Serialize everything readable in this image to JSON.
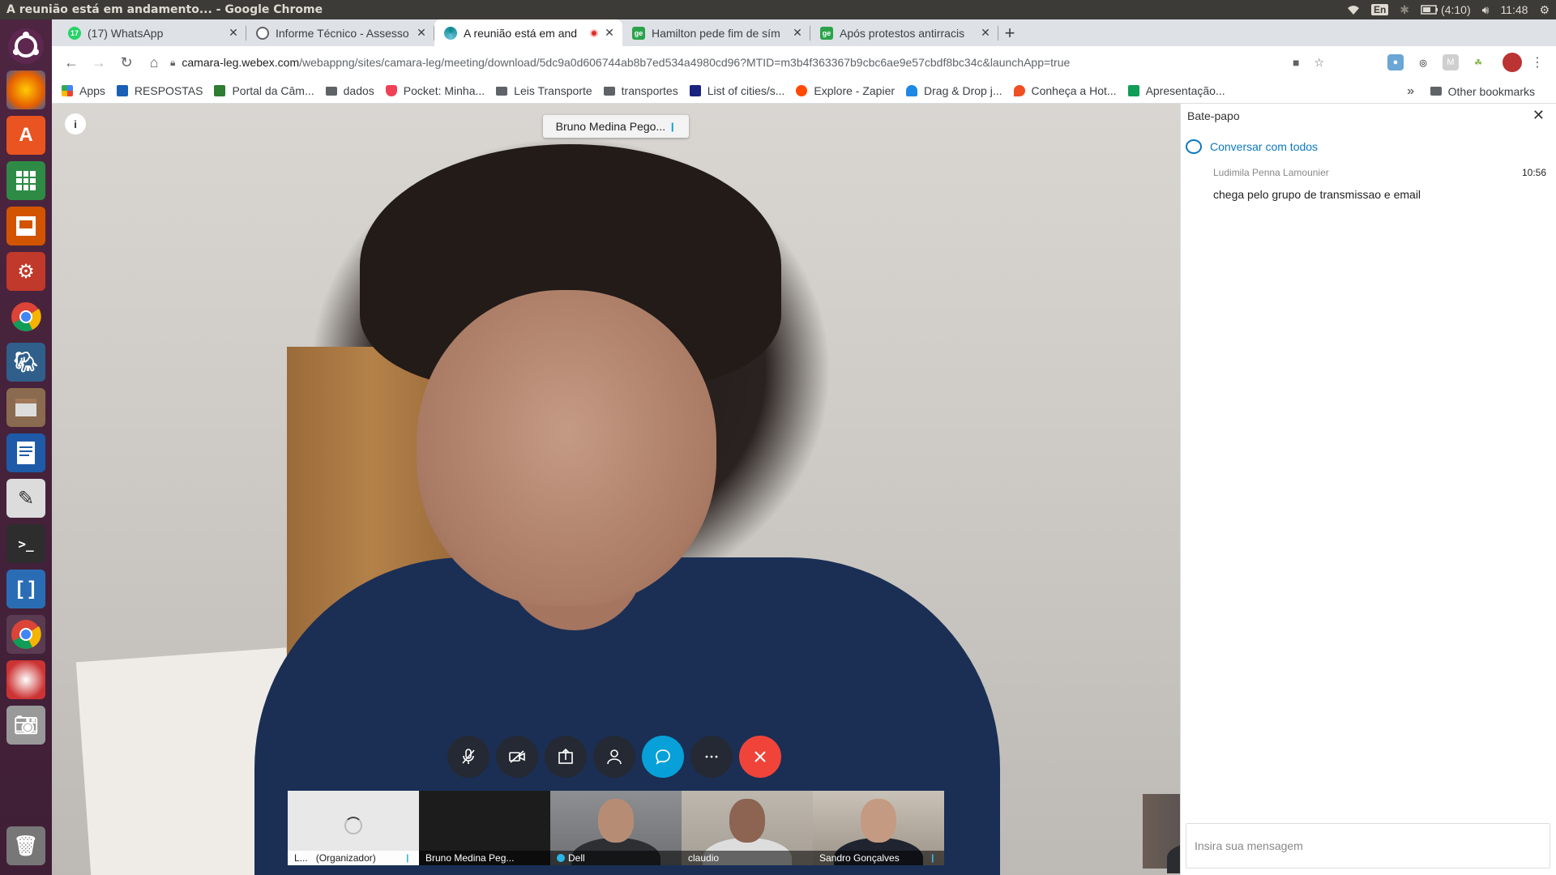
{
  "topbar": {
    "window_title": "A reunião está em andamento... - Google Chrome",
    "keyboard": "En",
    "battery": "(4:10)",
    "clock": "11:48"
  },
  "tabs": [
    {
      "title": "(17) WhatsApp",
      "favicon_color": "#25d366",
      "favicon_text": "17"
    },
    {
      "title": "Informe Técnico - Assesso",
      "favicon_color": "#5f6368",
      "favicon_text": ""
    },
    {
      "title": "A reunião está em and",
      "favicon_color": "#0b8a8f",
      "favicon_text": ""
    },
    {
      "title": "Hamilton pede fim de sím",
      "favicon_color": "#2aa34a",
      "favicon_text": "ge"
    },
    {
      "title": "Após protestos antirracis",
      "favicon_color": "#2aa34a",
      "favicon_text": "ge"
    }
  ],
  "address": {
    "host": "camara-leg.webex.com",
    "path": "/webappng/sites/camara-leg/meeting/download/5dc9a0d606744ab8b7ed534a4980cd96?MTID=m3b4f363367b9cbc6ae9e57cbdf8bc34c&launchApp=true"
  },
  "bookmarks": [
    {
      "label": "Apps",
      "icon": "apps-icon",
      "color": "#4285f4"
    },
    {
      "label": "RESPOSTAS",
      "icon": "respostas-icon",
      "color": "#1a5fb4"
    },
    {
      "label": "Portal da Câm...",
      "icon": "portal-icon",
      "color": "#2e7d32"
    },
    {
      "label": "dados",
      "icon": "folder-icon",
      "color": "#5f6368"
    },
    {
      "label": "Pocket: Minha...",
      "icon": "pocket-icon",
      "color": "#ef4056"
    },
    {
      "label": "Leis Transporte",
      "icon": "folder-icon",
      "color": "#5f6368"
    },
    {
      "label": "transportes",
      "icon": "folder-icon",
      "color": "#5f6368"
    },
    {
      "label": "List of cities/s...",
      "icon": "wikipedia-icon",
      "color": "#1a237e"
    },
    {
      "label": "Explore - Zapier",
      "icon": "zapier-icon",
      "color": "#ff4a00"
    },
    {
      "label": "Drag & Drop j...",
      "icon": "cloud-icon",
      "color": "#1e88e5"
    },
    {
      "label": "Conheça a Hot...",
      "icon": "hotmart-icon",
      "color": "#f04e23"
    },
    {
      "label": "Apresentação...",
      "icon": "slides-icon",
      "color": "#0f9d58"
    }
  ],
  "bookmarks_other": "Other bookmarks",
  "meeting": {
    "active_speaker": "Bruno Medina Pego...",
    "thumbnails": [
      {
        "name": "L...",
        "role": "(Organizador)",
        "type": "loading"
      },
      {
        "name": "Bruno Medina Peg...",
        "role": "",
        "type": "dark"
      },
      {
        "name": "Dell",
        "role": "",
        "type": "video"
      },
      {
        "name": "claudio",
        "role": "",
        "type": "video"
      },
      {
        "name": "Sandro Gonçalves",
        "role": "",
        "type": "video"
      }
    ]
  },
  "chat": {
    "title": "Bate-papo",
    "to_label": "Conversar com todos",
    "messages": [
      {
        "sender": "Ludimila Penna Lamounier",
        "time": "10:56",
        "text": "chega pelo grupo de transmissao e email"
      }
    ],
    "input_placeholder": "Insira sua mensagem"
  }
}
